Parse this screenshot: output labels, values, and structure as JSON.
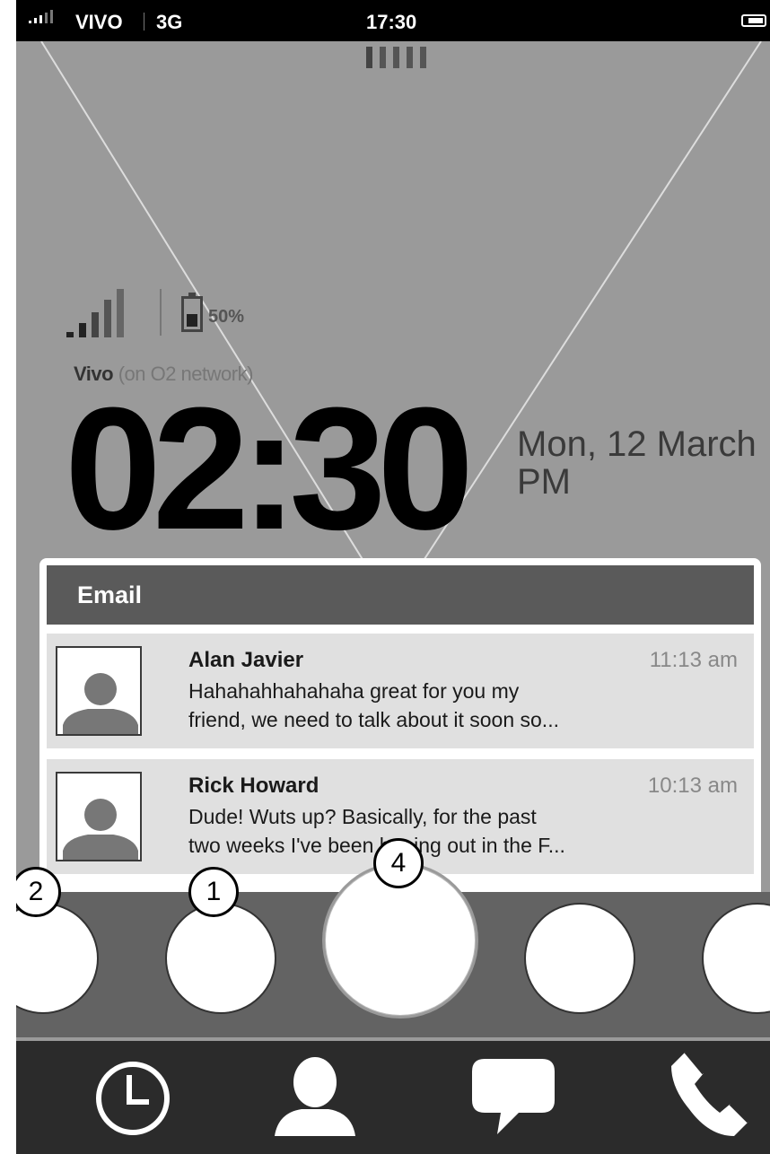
{
  "status_bar": {
    "carrier": "VIVO",
    "network_type": "3G",
    "time": "17:30"
  },
  "lock_screen": {
    "battery_percent": "50%",
    "carrier_name": "Vivo",
    "network_note": "(on O2 network)",
    "clock": "02:30",
    "date": "Mon, 12 March",
    "am_pm": "PM"
  },
  "email_card": {
    "title": "Email",
    "messages": [
      {
        "sender": "Alan Javier",
        "time": "11:13 am",
        "line1": "Hahahahhahahaha great for you my",
        "line2": "friend, we need to talk about it soon so..."
      },
      {
        "sender": "Rick Howard",
        "time": "10:13 am",
        "line1": "Dude! Wuts up? Basically, for the past",
        "line2": "two weeks I've been haning out in the F..."
      }
    ]
  },
  "dock": {
    "badges": [
      "2",
      "1",
      "4"
    ]
  },
  "tab_bar": {
    "icons": [
      "clock-icon",
      "contact-icon",
      "chat-bubble-icon",
      "phone-icon"
    ]
  }
}
